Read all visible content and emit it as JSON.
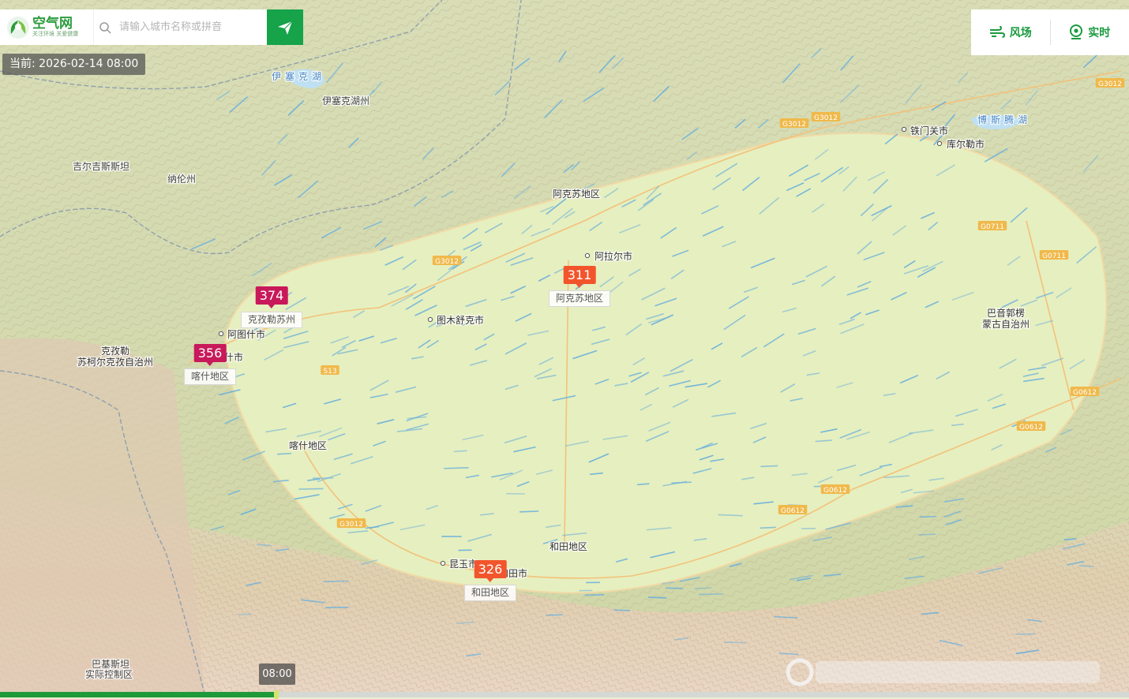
{
  "header": {
    "logo_title": "空气网",
    "logo_subtitle": "关注环境 关爱健康",
    "search_placeholder": "请输入城市名称或拼音",
    "search_value": ""
  },
  "current_time": "当前: 2026-02-14 08:00",
  "modes": [
    {
      "label": "风场",
      "icon": "wind-icon"
    },
    {
      "label": "实时",
      "icon": "location-pin-icon"
    }
  ],
  "markers": [
    {
      "aqi": "374",
      "region": "克孜勒苏州",
      "color": "#c8195a"
    },
    {
      "aqi": "356",
      "region": "喀什地区",
      "color": "#c8195a"
    },
    {
      "aqi": "311",
      "region": "阿克苏地区",
      "color": "#f2552c"
    },
    {
      "aqi": "326",
      "region": "和田地区",
      "color": "#f2552c"
    }
  ],
  "map_labels": [
    "伊塞克湖",
    "伊塞克湖州",
    "吉尔吉斯斯坦",
    "纳伦州",
    "阿克苏地区",
    "阿拉尔市",
    "图木舒克市",
    "阿图什市",
    "克孜勒",
    "苏柯尔克孜自治州",
    "什市",
    "喀什地区",
    "昆玉市",
    "和田市",
    "和田地区",
    "铁门关市",
    "库尔勒市",
    "博斯腾湖",
    "巴音郭楞",
    "蒙古自治州",
    "巴基斯坦",
    "实际控制区"
  ],
  "road_labels": [
    "G3012",
    "G3012",
    "G3012",
    "G3012",
    "G3012",
    "S13",
    "G0711",
    "G0711",
    "G0612",
    "G0612",
    "G0612",
    "G0612"
  ],
  "timeline": {
    "time_label": "08:00",
    "progress": 0.245
  },
  "colors": {
    "brand": "#16a34a",
    "severe": "#c8195a",
    "heavy": "#f2552c",
    "basin": "#e6efbf"
  }
}
